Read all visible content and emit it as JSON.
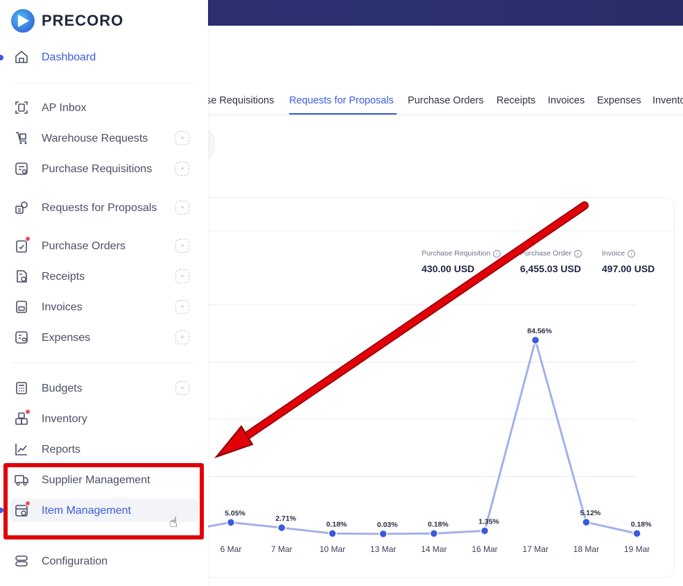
{
  "brand": {
    "name": "PRECORO"
  },
  "sidebar": {
    "items": [
      {
        "label": "Dashboard",
        "icon": "home-icon"
      },
      {
        "label": "AP Inbox",
        "icon": "scan-icon"
      },
      {
        "label": "Warehouse Requests",
        "icon": "cart-icon"
      },
      {
        "label": "Purchase Requisitions",
        "icon": "requisition-icon"
      },
      {
        "label": "Requests for Proposals",
        "icon": "rfp-icon"
      },
      {
        "label": "Purchase Orders",
        "icon": "order-icon"
      },
      {
        "label": "Receipts",
        "icon": "receipt-icon"
      },
      {
        "label": "Invoices",
        "icon": "invoice-icon"
      },
      {
        "label": "Expenses",
        "icon": "expense-icon"
      },
      {
        "label": "Budgets",
        "icon": "calculator-icon"
      },
      {
        "label": "Inventory",
        "icon": "boxes-icon"
      },
      {
        "label": "Reports",
        "icon": "chart-line-icon"
      },
      {
        "label": "Supplier Management",
        "icon": "truck-icon"
      },
      {
        "label": "Item Management",
        "icon": "item-box-icon"
      },
      {
        "label": "Configuration",
        "icon": "toggle-icon"
      }
    ]
  },
  "tabs": [
    {
      "label": "se Requisitions"
    },
    {
      "label": "Requests for Proposals"
    },
    {
      "label": "Purchase Orders"
    },
    {
      "label": "Receipts"
    },
    {
      "label": "Invoices"
    },
    {
      "label": "Expenses"
    },
    {
      "label": "Invento"
    }
  ],
  "stats": [
    {
      "label": "Purchase Requisition",
      "value": "430.00 USD"
    },
    {
      "label": "Purchase Order",
      "value": "6,455.03 USD"
    },
    {
      "label": "Invoice",
      "value": "497.00 USD"
    }
  ],
  "chart_data": {
    "type": "line",
    "categories": [
      "6 Mar",
      "7 Mar",
      "10 Mar",
      "13 Mar",
      "14 Mar",
      "16 Mar",
      "17 Mar",
      "18 Mar",
      "19 Mar"
    ],
    "values": [
      5.05,
      2.71,
      0.18,
      0.03,
      0.18,
      1.35,
      84.56,
      5.12,
      0.18
    ],
    "data_labels": [
      "5.05%",
      "2.71%",
      "0.18%",
      "0.03%",
      "0.18%",
      "1.35%",
      "84.56%",
      "5.12%",
      "0.18%"
    ],
    "ylim": [
      0,
      100
    ],
    "grid": true,
    "colors": {
      "line": "#a3b0ea",
      "point": "#3b5bdb"
    }
  },
  "colors": {
    "accent": "#3b5bdb",
    "header": "#2b2f6e",
    "annotation": "#e1000a"
  }
}
